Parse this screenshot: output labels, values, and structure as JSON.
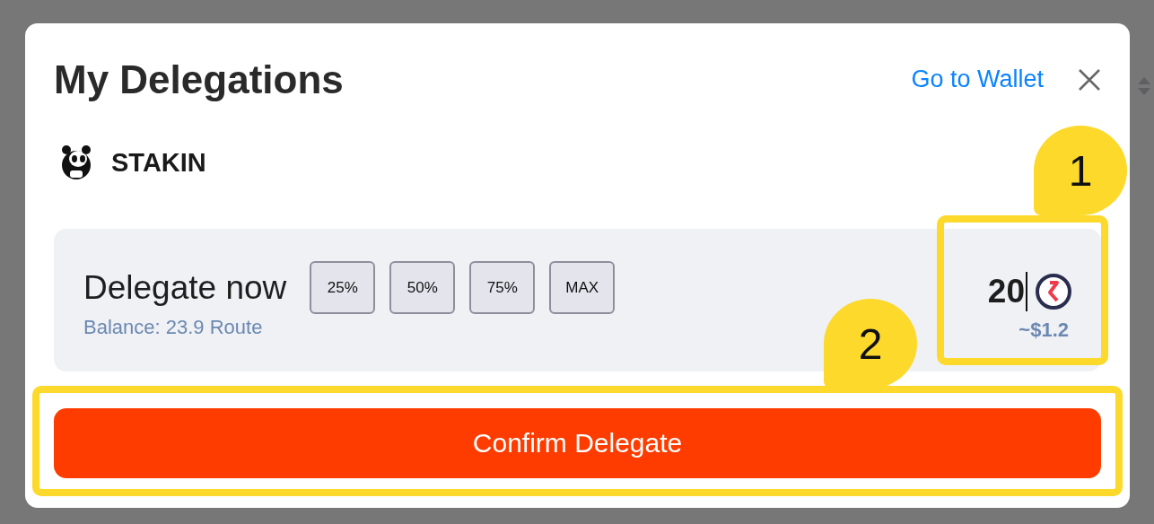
{
  "modal": {
    "title": "My Delegations",
    "wallet_link": "Go to Wallet"
  },
  "validator": {
    "name": "STAKIN"
  },
  "delegate": {
    "heading": "Delegate now",
    "balance": "Balance: 23.9 Route",
    "presets": [
      "25%",
      "50%",
      "75%",
      "MAX"
    ],
    "amount": "20",
    "usd_value": "~$1.2"
  },
  "confirm_button": "Confirm Delegate",
  "annotations": [
    {
      "label": "1"
    },
    {
      "label": "2"
    }
  ]
}
